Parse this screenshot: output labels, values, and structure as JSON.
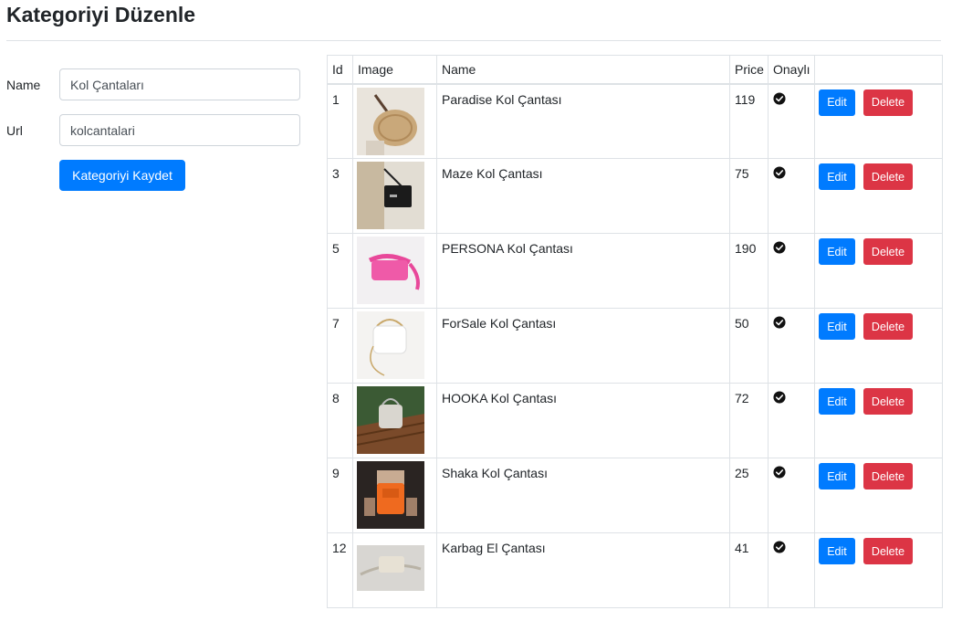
{
  "page": {
    "title": "Kategoriyi Düzenle"
  },
  "form": {
    "name_label": "Name",
    "name_value": "Kol Çantaları",
    "url_label": "Url",
    "url_value": "kolcantalari",
    "save_label": "Kategoriyi Kaydet"
  },
  "table": {
    "headers": {
      "id": "Id",
      "image": "Image",
      "name": "Name",
      "price": "Price",
      "approved": "Onaylı",
      "actions": ""
    },
    "edit_label": "Edit",
    "delete_label": "Delete",
    "rows": [
      {
        "id": "1",
        "name": "Paradise Kol Çantası",
        "price": "119",
        "approved": true,
        "image": "bag-beige-round"
      },
      {
        "id": "3",
        "name": "Maze Kol Çantası",
        "price": "75",
        "approved": true,
        "image": "bag-black"
      },
      {
        "id": "5",
        "name": "PERSONA Kol Çantası",
        "price": "190",
        "approved": true,
        "image": "bag-pink"
      },
      {
        "id": "7",
        "name": "ForSale Kol Çantası",
        "price": "50",
        "approved": true,
        "image": "bag-white-chain"
      },
      {
        "id": "8",
        "name": "HOOKA Kol Çantası",
        "price": "72",
        "approved": true,
        "image": "bag-silver-on-wood"
      },
      {
        "id": "9",
        "name": "Shaka Kol Çantası",
        "price": "25",
        "approved": true,
        "image": "bag-orange"
      },
      {
        "id": "12",
        "name": "Karbag El Çantası",
        "price": "41",
        "approved": true,
        "image": "bag-cream-flat"
      }
    ]
  },
  "colors": {
    "primary": "#007bff",
    "danger": "#dc3545",
    "border": "#dee2e6",
    "text": "#212529"
  }
}
